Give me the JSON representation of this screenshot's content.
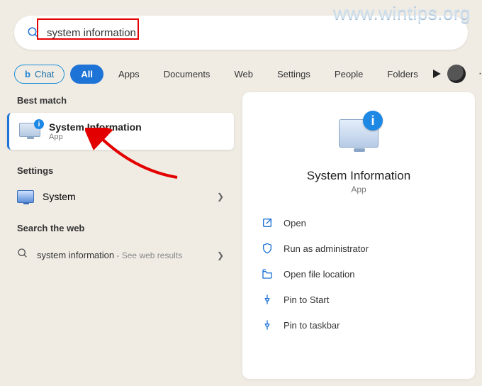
{
  "watermark": "www.wintips.org",
  "search": {
    "value": "system information"
  },
  "filters": {
    "chat": "Chat",
    "all": "All",
    "apps": "Apps",
    "documents": "Documents",
    "web": "Web",
    "settings": "Settings",
    "people": "People",
    "folders": "Folders"
  },
  "left": {
    "best_match_label": "Best match",
    "best": {
      "title": "System Information",
      "subtitle": "App"
    },
    "settings_label": "Settings",
    "settings_item": "System",
    "web_label": "Search the web",
    "web_item": "system information",
    "web_hint": " - See web results"
  },
  "right": {
    "title": "System Information",
    "subtitle": "App",
    "actions": {
      "open": "Open",
      "admin": "Run as administrator",
      "location": "Open file location",
      "pin_start": "Pin to Start",
      "pin_taskbar": "Pin to taskbar"
    }
  }
}
